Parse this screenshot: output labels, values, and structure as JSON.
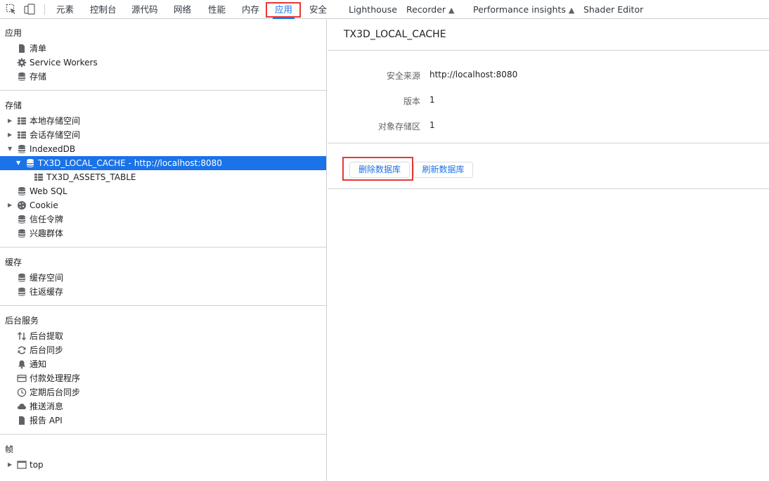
{
  "toolbar": {
    "inspect_icon": "inspect-element-icon",
    "device_icon": "device-toolbar-icon",
    "tabs": [
      "元素",
      "控制台",
      "源代码",
      "网络",
      "性能",
      "内存",
      "应用",
      "安全",
      "Lighthouse",
      "Recorder",
      "Performance insights",
      "Shader Editor"
    ],
    "active_tab": "应用",
    "experimental_icon": "flask-icon"
  },
  "sidebar": {
    "sections": {
      "app": "应用",
      "storage": "存储",
      "cache": "缓存",
      "background": "后台服务",
      "frames": "帧"
    },
    "app_items": [
      {
        "label": "清单",
        "icon": "file-icon"
      },
      {
        "label": "Service Workers",
        "icon": "gear-icon"
      },
      {
        "label": "存储",
        "icon": "database-icon"
      }
    ],
    "storage_items": [
      {
        "label": "本地存储空间",
        "icon": "table-icon",
        "expandable": true
      },
      {
        "label": "会话存储空间",
        "icon": "table-icon",
        "expandable": true
      },
      {
        "label": "IndexedDB",
        "icon": "database-icon",
        "expanded": true
      },
      {
        "label": "TX3D_LOCAL_CACHE - http://localhost:8080",
        "icon": "database-icon",
        "expanded": true,
        "selected": true
      },
      {
        "label": "TX3D_ASSETS_TABLE",
        "icon": "table-icon"
      },
      {
        "label": "Web SQL",
        "icon": "database-icon"
      },
      {
        "label": "Cookie",
        "icon": "cookie-icon",
        "expandable": true
      },
      {
        "label": "信任令牌",
        "icon": "database-icon"
      },
      {
        "label": "兴趣群体",
        "icon": "database-icon"
      }
    ],
    "cache_items": [
      {
        "label": "缓存空间",
        "icon": "database-icon"
      },
      {
        "label": "往返缓存",
        "icon": "database-icon"
      }
    ],
    "background_items": [
      {
        "label": "后台提取",
        "icon": "up-down-arrows-icon"
      },
      {
        "label": "后台同步",
        "icon": "sync-icon"
      },
      {
        "label": "通知",
        "icon": "bell-icon"
      },
      {
        "label": "付款处理程序",
        "icon": "credit-card-icon"
      },
      {
        "label": "定期后台同步",
        "icon": "clock-icon"
      },
      {
        "label": "推送消息",
        "icon": "cloud-icon"
      },
      {
        "label": "报告 API",
        "icon": "file-icon"
      }
    ],
    "frame_items": [
      {
        "label": "top",
        "icon": "frame-icon",
        "expandable": true
      }
    ]
  },
  "main": {
    "title": "TX3D_LOCAL_CACHE",
    "security_origin_label": "安全来源",
    "security_origin_value": "http://localhost:8080",
    "version_label": "版本",
    "version_value": "1",
    "object_stores_label": "对象存储区",
    "object_stores_value": "1",
    "delete_button": "删除数据库",
    "refresh_button": "刷新数据库"
  },
  "colors": {
    "accent": "#1a73e8",
    "highlight_box": "#e53935"
  }
}
